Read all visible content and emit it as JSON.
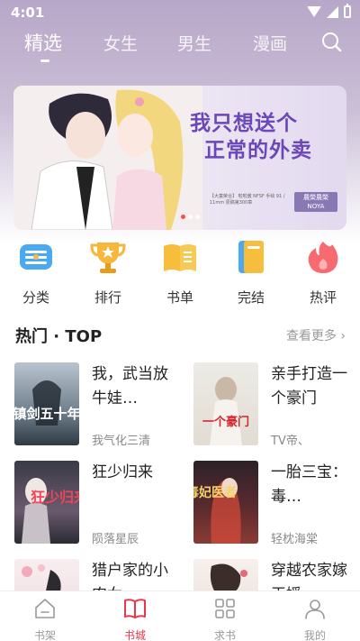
{
  "status_bar": {
    "time": "4:01"
  },
  "category_tabs": [
    {
      "label": "精选",
      "active": true
    },
    {
      "label": "女生",
      "active": false
    },
    {
      "label": "男生",
      "active": false
    },
    {
      "label": "漫画",
      "active": false
    }
  ],
  "banner": {
    "title_line1": "我只想送个",
    "title_line2": "正常的外卖",
    "info": "【大童荣合】 啦啦酱 NFSF 手绘 91 / 11mm 原稿第300章",
    "logo_line1": "農榮農榮",
    "logo_line2": "NOYA"
  },
  "quick_menu": [
    {
      "label": "分类",
      "icon": "category-icon"
    },
    {
      "label": "排行",
      "icon": "trophy-icon"
    },
    {
      "label": "书单",
      "icon": "booklist-icon"
    },
    {
      "label": "完结",
      "icon": "finished-book-icon"
    },
    {
      "label": "热评",
      "icon": "hot-comment-icon"
    }
  ],
  "hot_section": {
    "title": "热门 · TOP",
    "more_label": "查看更多",
    "books": [
      {
        "title": "我，武当放牛娃…",
        "author": "我气化三清",
        "cover_text": "镇剑五十年"
      },
      {
        "title": "亲手打造一个豪门",
        "author": "TV帝、",
        "cover_text": "一个豪门"
      },
      {
        "title": "狂少归来",
        "author": "陨落星辰",
        "cover_text": "狂少归来"
      },
      {
        "title": "一胎三宝：毒…",
        "author": "轻枕海棠",
        "cover_text": "毒妃医者"
      },
      {
        "title": "猎户家的小农女",
        "author": "",
        "cover_text": ""
      },
      {
        "title": "穿越农家嫁玉媛",
        "author": "",
        "cover_text": ""
      }
    ]
  },
  "bottom_nav": [
    {
      "label": "书架",
      "icon": "bookshelf-icon",
      "active": false
    },
    {
      "label": "书城",
      "icon": "bookstore-icon",
      "active": true
    },
    {
      "label": "求书",
      "icon": "request-book-icon",
      "active": false
    },
    {
      "label": "我的",
      "icon": "profile-icon",
      "active": false
    }
  ],
  "colors": {
    "accent": "#e8374a",
    "banner_title": "#6c47b8"
  }
}
